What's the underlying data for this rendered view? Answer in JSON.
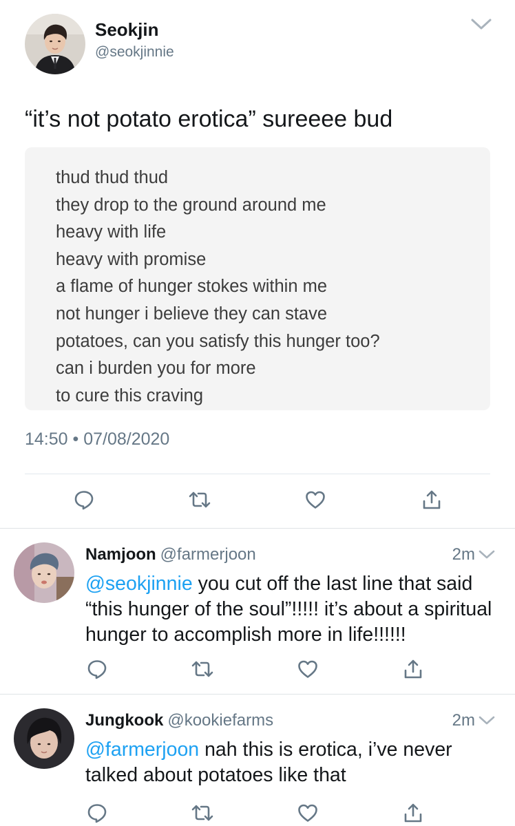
{
  "main_tweet": {
    "author_name": "Seokjin",
    "author_handle": "@seokjinnie",
    "text": "“it’s not potato erotica” sureeee bud",
    "quote_lines": [
      "thud thud thud",
      "they drop to the ground around me",
      "heavy with life",
      "heavy with promise",
      "a flame of hunger stokes within me",
      "not hunger i believe they can stave",
      "potatoes, can you satisfy this hunger too?",
      "can i burden you for more",
      "to cure this craving"
    ],
    "timestamp": "14:50 • 07/08/2020",
    "actions": [
      "reply-icon",
      "retweet-icon",
      "like-icon",
      "share-icon"
    ]
  },
  "replies": [
    {
      "author_name": "Namjoon",
      "author_handle": "@farmerjoon",
      "time": "2m",
      "mention": "@seokjinnie",
      "text": " you cut off the last line that said “this hunger of the soul”!!!!! it’s about a spiritual hunger to accomplish more in life!!!!!!"
    },
    {
      "author_name": "Jungkook",
      "author_handle": "@kookiefarms",
      "time": "2m",
      "mention": "@farmerjoon",
      "text": " nah this is erotica, i’ve never talked about potatoes like that"
    }
  ],
  "colors": {
    "link": "#1da1f2",
    "secondary_text": "#657786",
    "icon": "#657786",
    "quote_background": "#f4f4f4"
  }
}
